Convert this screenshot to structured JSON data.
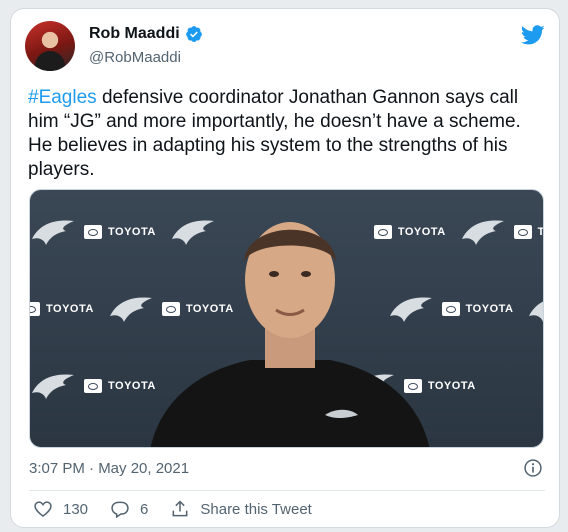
{
  "tweet": {
    "author_name": "Rob Maaddi",
    "author_handle": "@RobMaaddi",
    "text_hashtag": "#Eagles",
    "text_body": " defensive coordinator Jonathan Gannon says call him “JG” and more importantly, he doesn’t have a scheme. He believes in adapting his system to the strengths of his players.",
    "timestamp": "3:07 PM · May 20, 2021",
    "likes": "130",
    "replies": "6",
    "share_label": "Share this Tweet"
  },
  "media": {
    "sponsor_word": "TOYOTA"
  },
  "icons": {
    "verified": "verified-badge-icon",
    "brand": "twitter-bird-icon",
    "info": "info-icon",
    "like": "heart-icon",
    "reply": "reply-icon",
    "share": "share-icon"
  },
  "colors": {
    "accent": "#1d9bf0",
    "text": "#0f1419",
    "muted": "#536471"
  }
}
